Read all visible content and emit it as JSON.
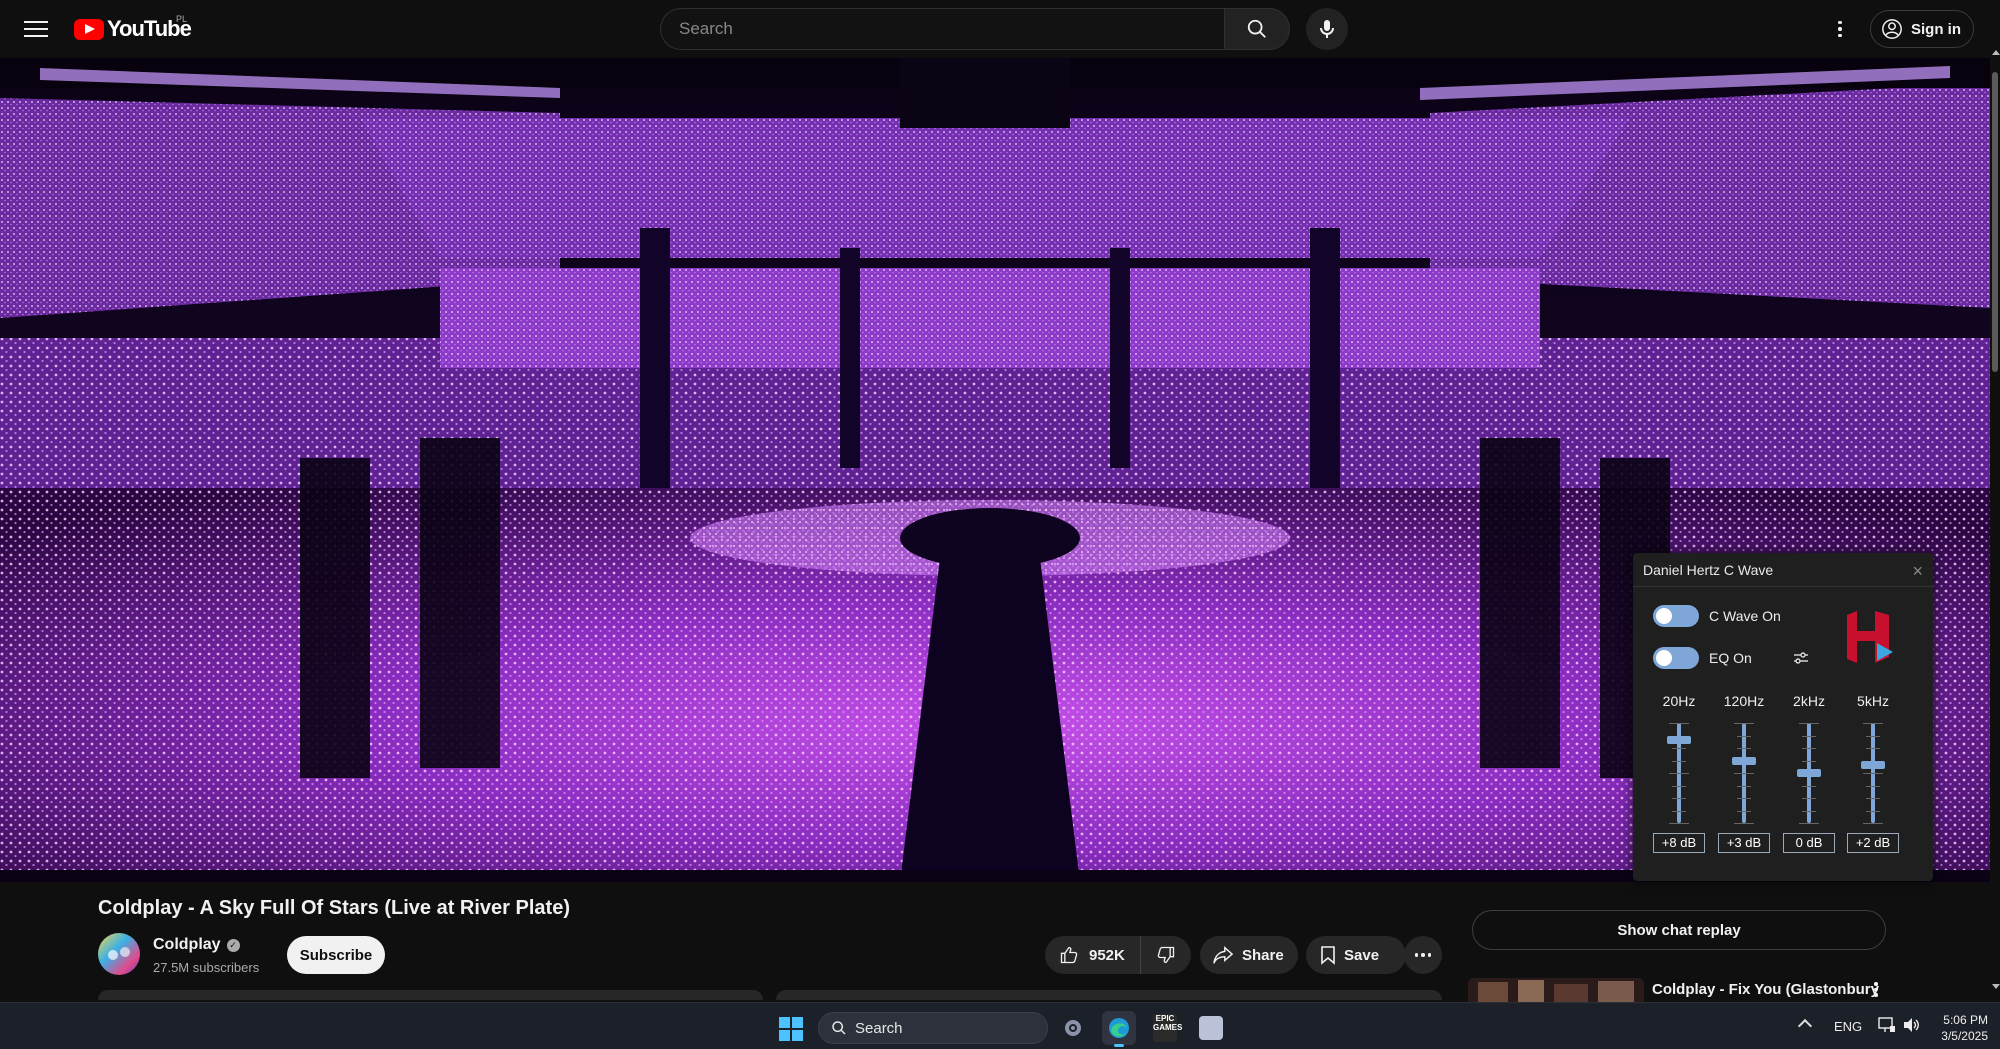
{
  "header": {
    "logo_text": "YouTube",
    "region": "PL",
    "search_placeholder": "Search",
    "signin_label": "Sign in"
  },
  "eq_panel": {
    "title": "Daniel Hertz C Wave",
    "toggles": [
      {
        "label": "C Wave On",
        "on": true
      },
      {
        "label": "EQ On",
        "on": true
      }
    ],
    "bands": [
      {
        "label": "20Hz",
        "value_label": "+8 dB",
        "db": 8
      },
      {
        "label": "120Hz",
        "value_label": "+3 dB",
        "db": 3
      },
      {
        "label": "2kHz",
        "value_label": "0 dB",
        "db": 0
      },
      {
        "label": "5kHz",
        "value_label": "+2 dB",
        "db": 2
      }
    ],
    "accent_color": "#7ea7d8"
  },
  "video": {
    "title": "Coldplay - A Sky Full Of Stars (Live at River Plate)",
    "channel_name": "Coldplay",
    "subscribers": "27.5M subscribers",
    "subscribe_label": "Subscribe",
    "likes": "952K",
    "share_label": "Share",
    "save_label": "Save"
  },
  "sidebar": {
    "chat_replay_label": "Show chat replay",
    "recommendation_title": "Coldplay - Fix You (Glastonbury"
  },
  "taskbar": {
    "search_label": "Search",
    "language": "ENG",
    "time": "5:06 PM",
    "date": "3/5/2025"
  }
}
